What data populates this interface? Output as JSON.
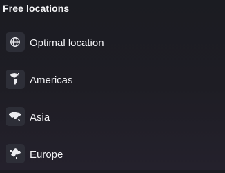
{
  "section": {
    "title": "Free locations"
  },
  "locations": [
    {
      "label": "Optimal location",
      "icon": "globe-icon"
    },
    {
      "label": "Americas",
      "icon": "americas-map-icon"
    },
    {
      "label": "Asia",
      "icon": "asia-map-icon"
    },
    {
      "label": "Europe",
      "icon": "europe-map-icon"
    }
  ],
  "colors": {
    "background": "#1e1d24",
    "icon_tile": "#2d2e37",
    "text": "#f2f2f5"
  }
}
